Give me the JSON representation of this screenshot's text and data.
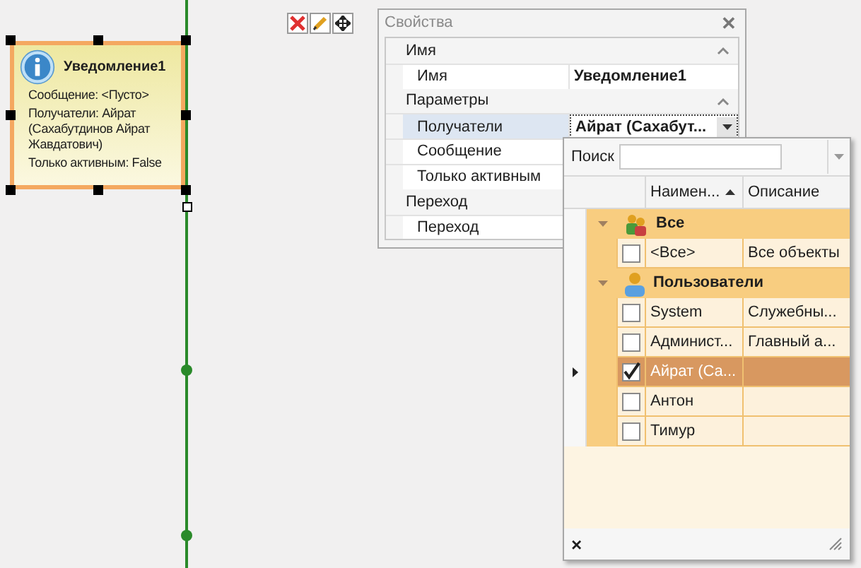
{
  "node": {
    "title": "Уведомление1",
    "lines": [
      "Сообщение: <Пусто>",
      "Получатели: Айрат (Сахабутдинов Айрат Жавдатович)",
      "Только активным: False"
    ],
    "selected": true
  },
  "properties": {
    "title": "Свойства",
    "close_label": "✕",
    "categories": [
      {
        "name": "Имя",
        "expanded": true,
        "rows": [
          {
            "label": "Имя",
            "value": "Уведомление1",
            "selected": false
          }
        ]
      },
      {
        "name": "Параметры",
        "expanded": true,
        "rows": [
          {
            "label": "Получатели",
            "value": "Айрат (Сахабут...",
            "selected": true
          },
          {
            "label": "Сообщение",
            "selected": false
          },
          {
            "label": "Только активным",
            "selected": false
          }
        ]
      },
      {
        "name": "Переход",
        "expanded": true,
        "rows": [
          {
            "label": "Переход",
            "selected": false
          }
        ]
      }
    ]
  },
  "dropdown": {
    "search_label": "Поиск",
    "columns": [
      "Наимен...",
      "Описание"
    ],
    "groups": [
      {
        "name": "Все",
        "expanded": true,
        "rows": [
          {
            "name": "<Все>",
            "description": "Все объекты",
            "checked": false,
            "selected": false
          }
        ]
      },
      {
        "name": "Пользователи",
        "expanded": true,
        "rows": [
          {
            "name": "System",
            "description": "Служебны...",
            "checked": false,
            "selected": false
          },
          {
            "name": "Админист...",
            "description": "Главный а...",
            "checked": false,
            "selected": false
          },
          {
            "name": "Айрат (Са...",
            "checked": true,
            "selected": true
          },
          {
            "name": "Антон",
            "checked": false,
            "selected": false
          },
          {
            "name": "Тимур",
            "checked": false,
            "selected": false
          }
        ]
      }
    ],
    "close_label": "×"
  }
}
